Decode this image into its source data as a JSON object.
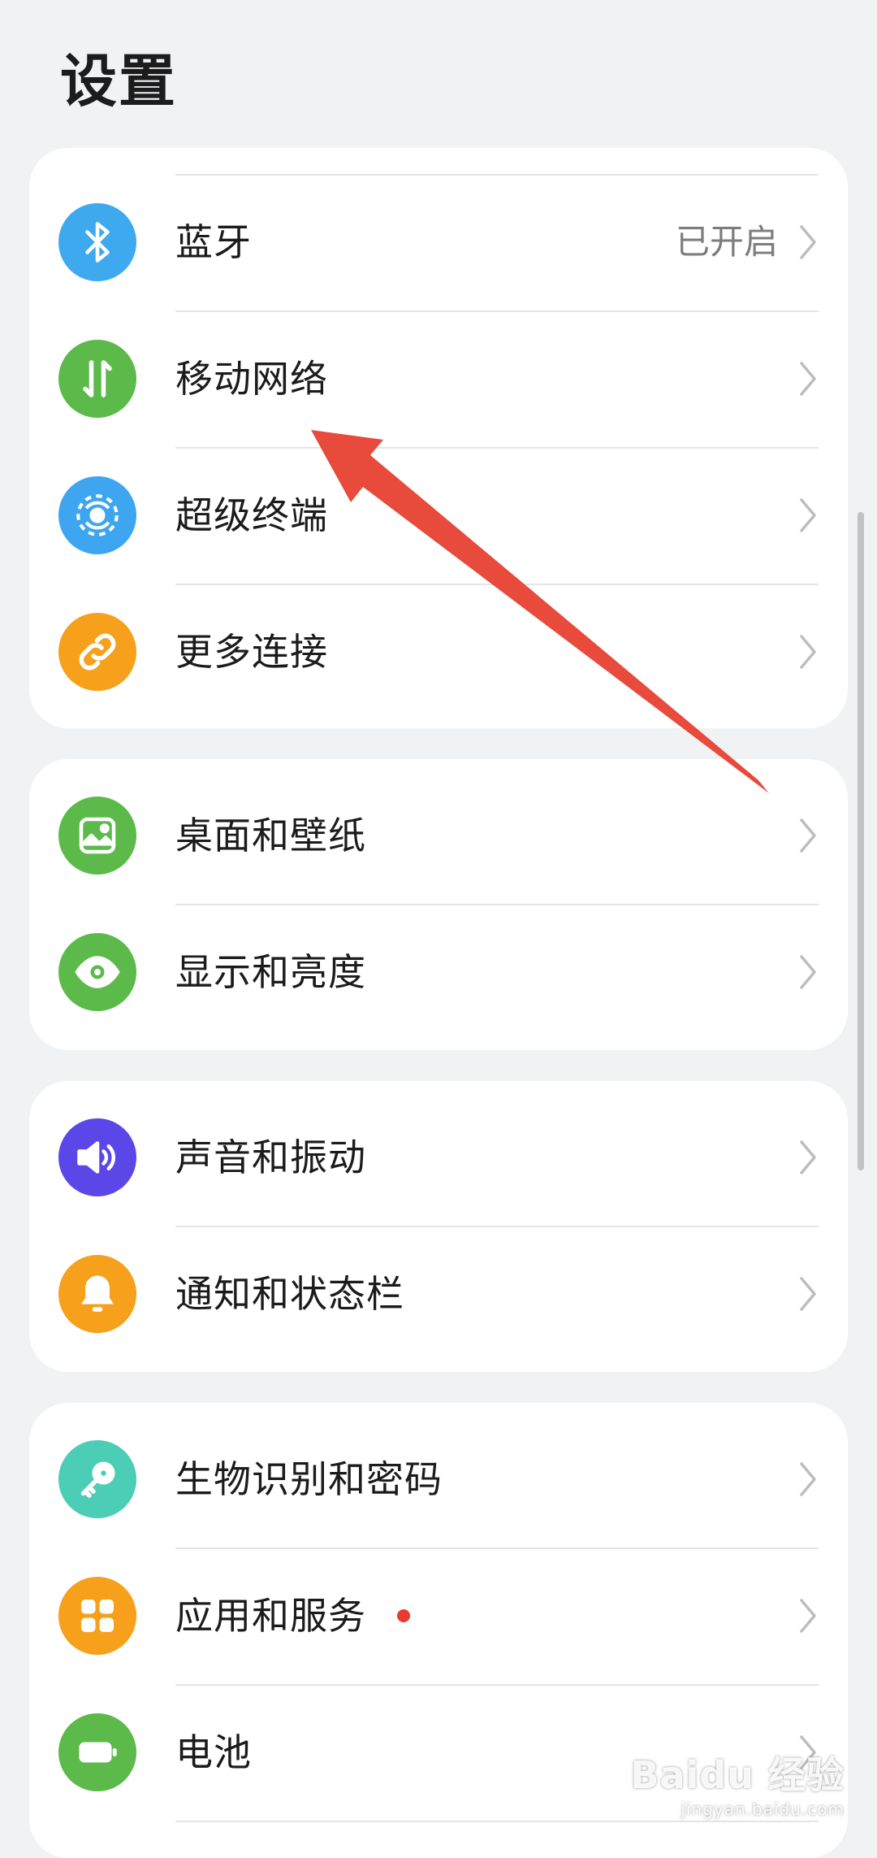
{
  "header": {
    "title": "设置"
  },
  "groups": [
    {
      "items": [
        {
          "label": "蓝牙",
          "value": "已开启",
          "icon": "bluetooth-icon",
          "color": "#3fa9f0"
        },
        {
          "label": "移动网络",
          "icon": "mobile-data-icon",
          "color": "#5cba4b"
        },
        {
          "label": "超级终端",
          "icon": "super-device-icon",
          "color": "#3ea6f0"
        },
        {
          "label": "更多连接",
          "icon": "link-icon",
          "color": "#f6a01c"
        }
      ]
    },
    {
      "items": [
        {
          "label": "桌面和壁纸",
          "icon": "wallpaper-icon",
          "color": "#5cba4b"
        },
        {
          "label": "显示和亮度",
          "icon": "eye-icon",
          "color": "#5cba4b"
        }
      ]
    },
    {
      "items": [
        {
          "label": "声音和振动",
          "icon": "speaker-icon",
          "color": "#5b47e8"
        },
        {
          "label": "通知和状态栏",
          "icon": "bell-icon",
          "color": "#f6a01c"
        }
      ]
    },
    {
      "items": [
        {
          "label": "生物识别和密码",
          "icon": "key-icon",
          "color": "#4ccdb6"
        },
        {
          "label": "应用和服务",
          "icon": "apps-icon",
          "color": "#f6a01c",
          "badge": "red-dot"
        },
        {
          "label": "电池",
          "icon": "battery-icon",
          "color": "#5cba4b"
        }
      ]
    }
  ],
  "annotation": {
    "color": "#e84a3c",
    "target": "移动网络"
  },
  "watermark": {
    "logo": "Baidu 经验",
    "url": "jingyan.baidu.com"
  }
}
